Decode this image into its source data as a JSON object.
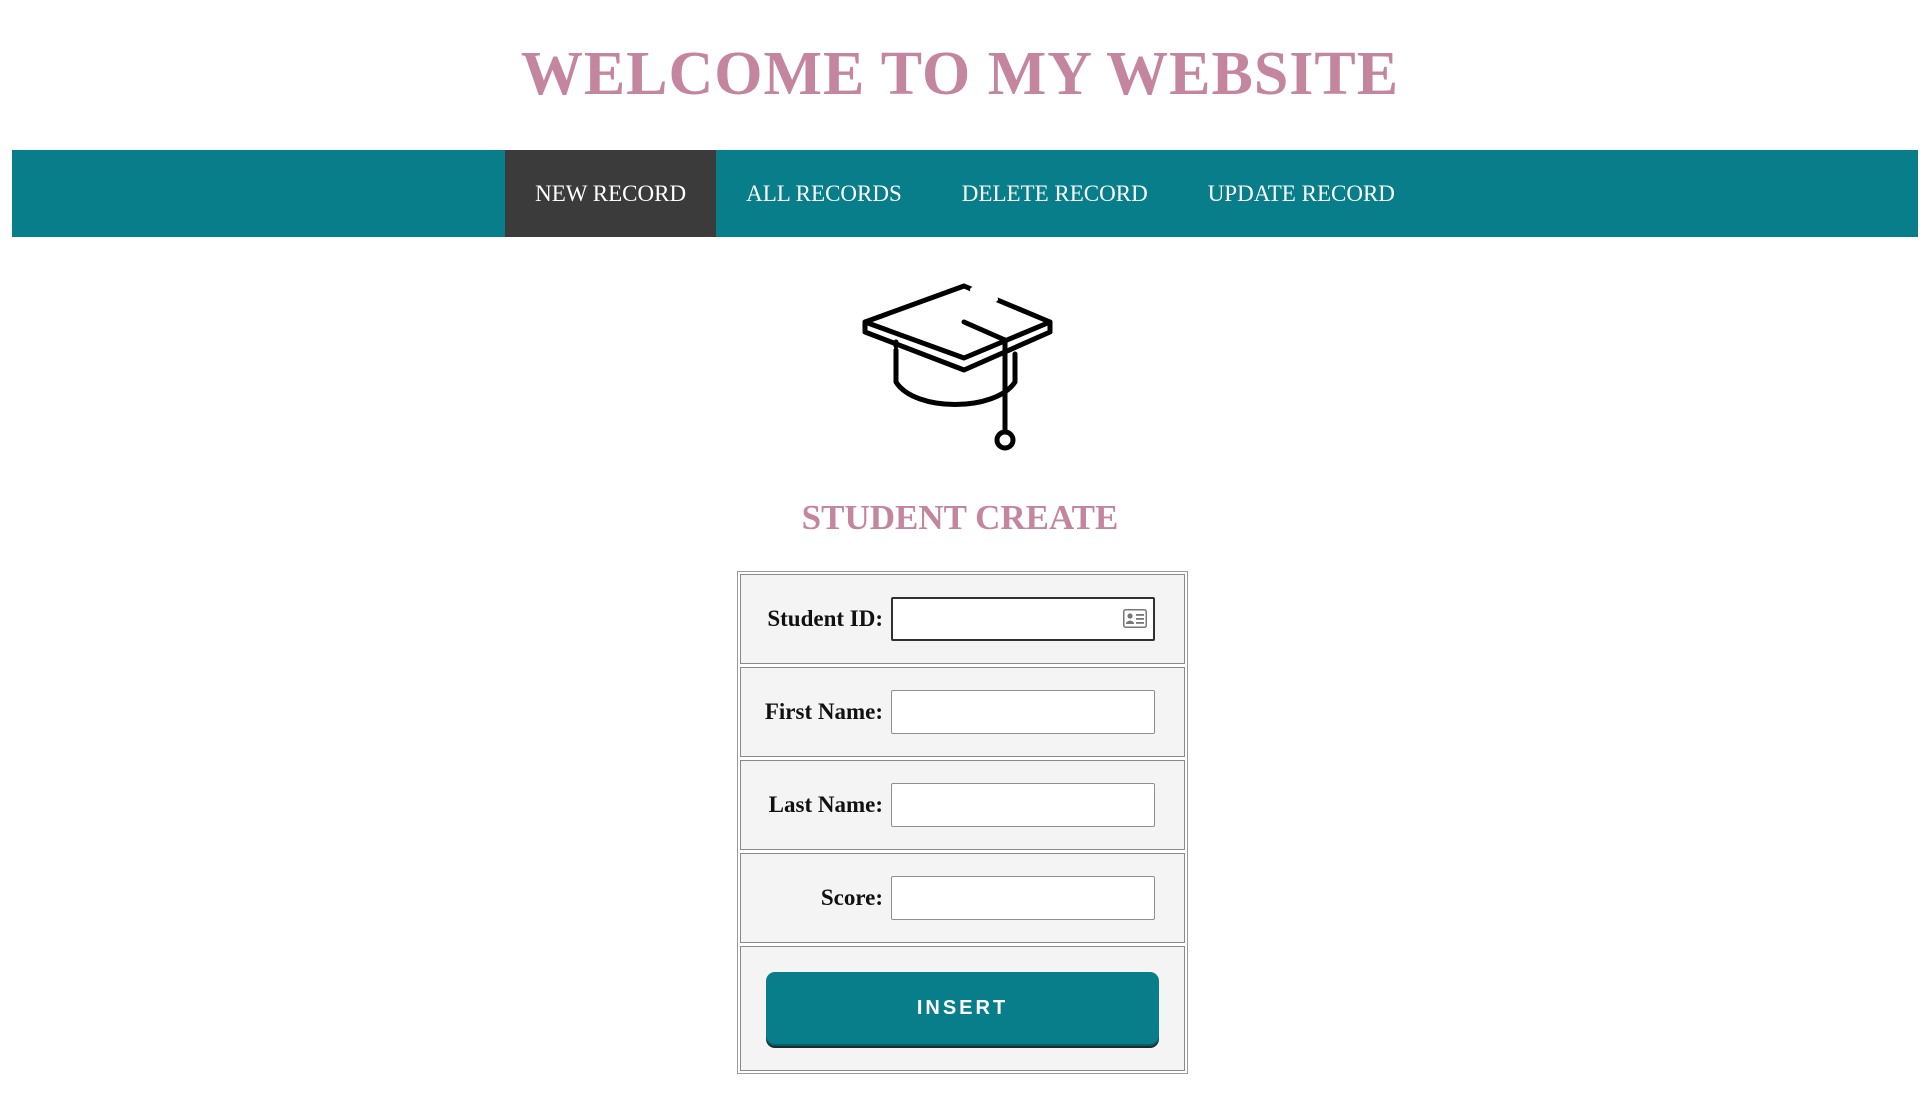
{
  "colors": {
    "title": "#c4869f",
    "nav_bg": "#087e8b",
    "nav_active_bg": "#3b3b3b",
    "button_bg": "#087e8b"
  },
  "header": {
    "title": "WELCOME TO MY WEBSITE"
  },
  "nav": {
    "items": [
      {
        "label": "NEW RECORD",
        "active": true
      },
      {
        "label": "ALL RECORDS",
        "active": false
      },
      {
        "label": "DELETE RECORD",
        "active": false
      },
      {
        "label": "UPDATE RECORD",
        "active": false
      }
    ]
  },
  "hero": {
    "icon": "graduation-cap-icon"
  },
  "form": {
    "title": "STUDENT CREATE",
    "fields": [
      {
        "label": "Student ID:",
        "value": "",
        "focused": true,
        "icon": "contact-card-icon"
      },
      {
        "label": "First Name:",
        "value": ""
      },
      {
        "label": "Last Name:",
        "value": ""
      },
      {
        "label": "Score:",
        "value": ""
      }
    ],
    "submit_label": "INSERT"
  }
}
